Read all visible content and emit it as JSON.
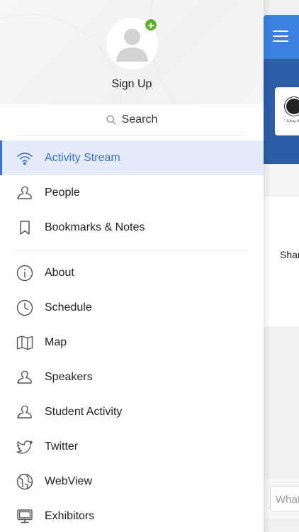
{
  "profile": {
    "signup_label": "Sign Up",
    "add_badge": "+"
  },
  "search": {
    "label": "Search"
  },
  "menu": {
    "items": [
      {
        "label": "Activity Stream",
        "icon": "wifi-icon",
        "active": true
      },
      {
        "label": "People",
        "icon": "person-icon"
      },
      {
        "label": "Bookmarks & Notes",
        "icon": "bookmark-icon"
      },
      {
        "label": "About",
        "icon": "info-icon"
      },
      {
        "label": "Schedule",
        "icon": "clock-icon"
      },
      {
        "label": "Map",
        "icon": "map-icon"
      },
      {
        "label": "Speakers",
        "icon": "speakers-icon"
      },
      {
        "label": "Student Activity",
        "icon": "person-icon"
      },
      {
        "label": "Twitter",
        "icon": "twitter-icon"
      },
      {
        "label": "WebView",
        "icon": "globe-icon"
      },
      {
        "label": "Exhibitors",
        "icon": "monitor-icon"
      }
    ]
  },
  "background": {
    "banner_motto": "\" Lifting A",
    "share_text": "Shar",
    "comment_placeholder": "What"
  },
  "colors": {
    "accent": "#3b6fcf",
    "active_bg": "#e4ecf9",
    "topbar": "#3b82df",
    "banner": "#2d5ea8",
    "badge": "#5fb02d"
  }
}
